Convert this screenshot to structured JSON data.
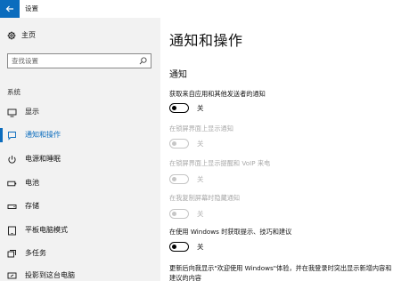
{
  "window": {
    "title": "设置"
  },
  "sidebar": {
    "home_label": "主页",
    "search_placeholder": "查找设置",
    "section_label": "系统",
    "items": [
      {
        "label": "显示",
        "icon": "monitor-icon"
      },
      {
        "label": "通知和操作",
        "icon": "notification-icon",
        "active": true
      },
      {
        "label": "电源和睡眠",
        "icon": "power-icon"
      },
      {
        "label": "电池",
        "icon": "battery-icon"
      },
      {
        "label": "存储",
        "icon": "storage-icon"
      },
      {
        "label": "平板电脑模式",
        "icon": "tablet-icon"
      },
      {
        "label": "多任务",
        "icon": "multitask-icon"
      },
      {
        "label": "投影到这台电脑",
        "icon": "project-icon"
      }
    ]
  },
  "main": {
    "title": "通知和操作",
    "section_title": "通知",
    "options": [
      {
        "label": "获取来自应用和其他发送者的通知",
        "state": "关",
        "enabled": true
      },
      {
        "label": "在锁屏界面上显示通知",
        "state": "关",
        "enabled": false
      },
      {
        "label": "在锁屏界面上显示提醒和 VoIP 来电",
        "state": "关",
        "enabled": false
      },
      {
        "label": "在我复制屏幕时隐藏通知",
        "state": "关",
        "enabled": false
      },
      {
        "label": "在使用 Windows 时获取提示、技巧和建议",
        "state": "关",
        "enabled": true
      }
    ],
    "last_option": "更新后向我显示\"欢迎使用 Windows\"体验，并在我登录时突出显示新增内容和建议的内容"
  },
  "colors": {
    "accent": "#0b6cbd",
    "sidebar_bg": "#f2f2f2",
    "disabled": "#c6c6c6"
  }
}
